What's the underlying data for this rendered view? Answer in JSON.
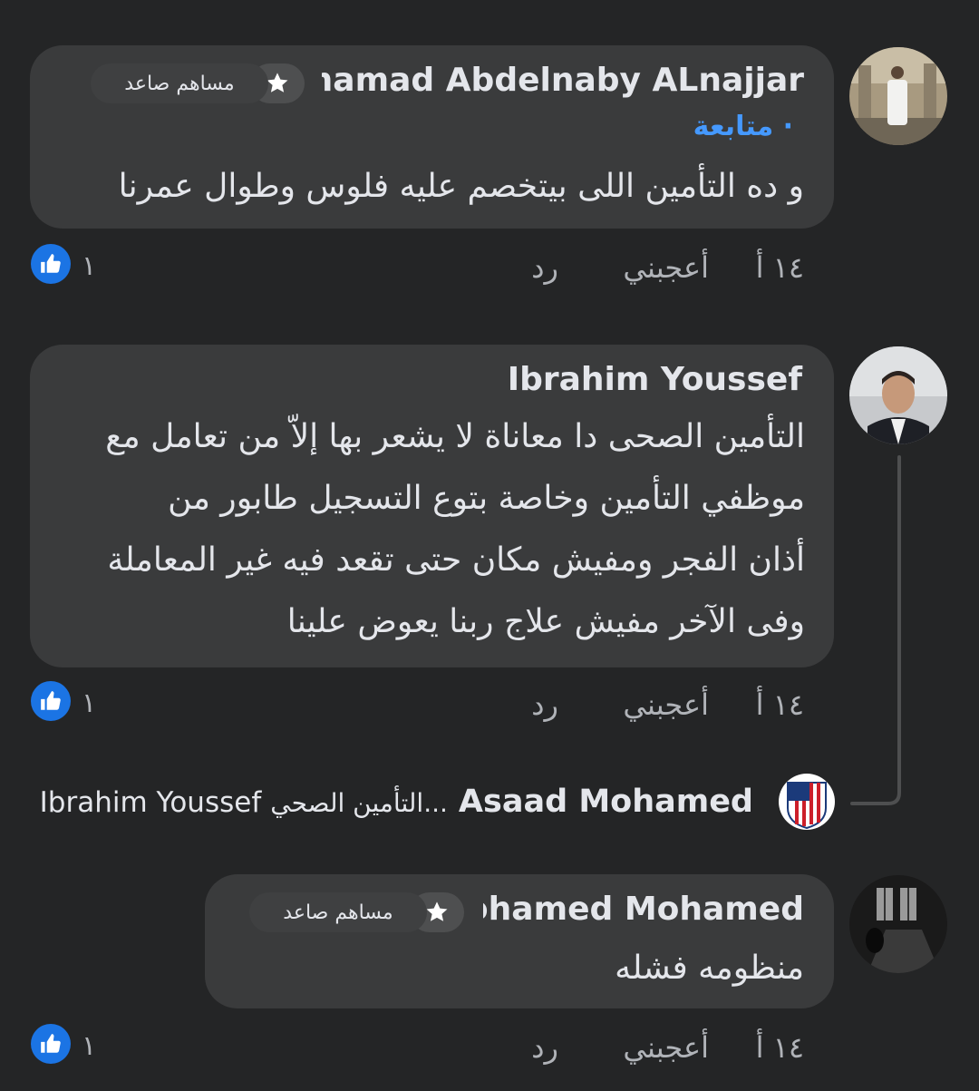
{
  "comments": [
    {
      "author": "Mohamad Abdelnaby ALnajjar",
      "badge": "مساهم صاعد",
      "follow": "· متابعة",
      "text": "و ده التأمين اللى بيتخصم عليه فلوس وطوال عمرنا",
      "time": "١٤ أ",
      "like": "أعجبني",
      "reply": "رد",
      "reactions": "١"
    },
    {
      "author": "Ibrahim Youssef",
      "text_lines": [
        "التأمين الصحى دا معاناة لا يشعر بها إلاّ من تعامل مع",
        "موظفي التأمين وخاصة بتوع التسجيل طابور من",
        "أذان الفجر ومفيش مكان حتى تقعد فيه غير المعاملة",
        "وفى الآخر مفيش علاج ربنا يعوض علينا"
      ],
      "time": "١٤ أ",
      "like": "أعجبني",
      "reply": "رد",
      "reactions": "١"
    },
    {
      "author": "Mohamed Mohamed",
      "badge": "مساهم صاعد",
      "text": "منظومه فشله",
      "time": "١٤ أ",
      "like": "أعجبني",
      "reply": "رد",
      "reactions": "١"
    }
  ],
  "reply_preview": {
    "author": "Asaad Mohamed",
    "snippet": "التأمين الصحي...",
    "target": "Ibrahim Youssef"
  },
  "colors": {
    "background": "#242526",
    "bubble": "#3a3b3c",
    "link": "#4599ff",
    "like_blue": "#1b74e4"
  }
}
